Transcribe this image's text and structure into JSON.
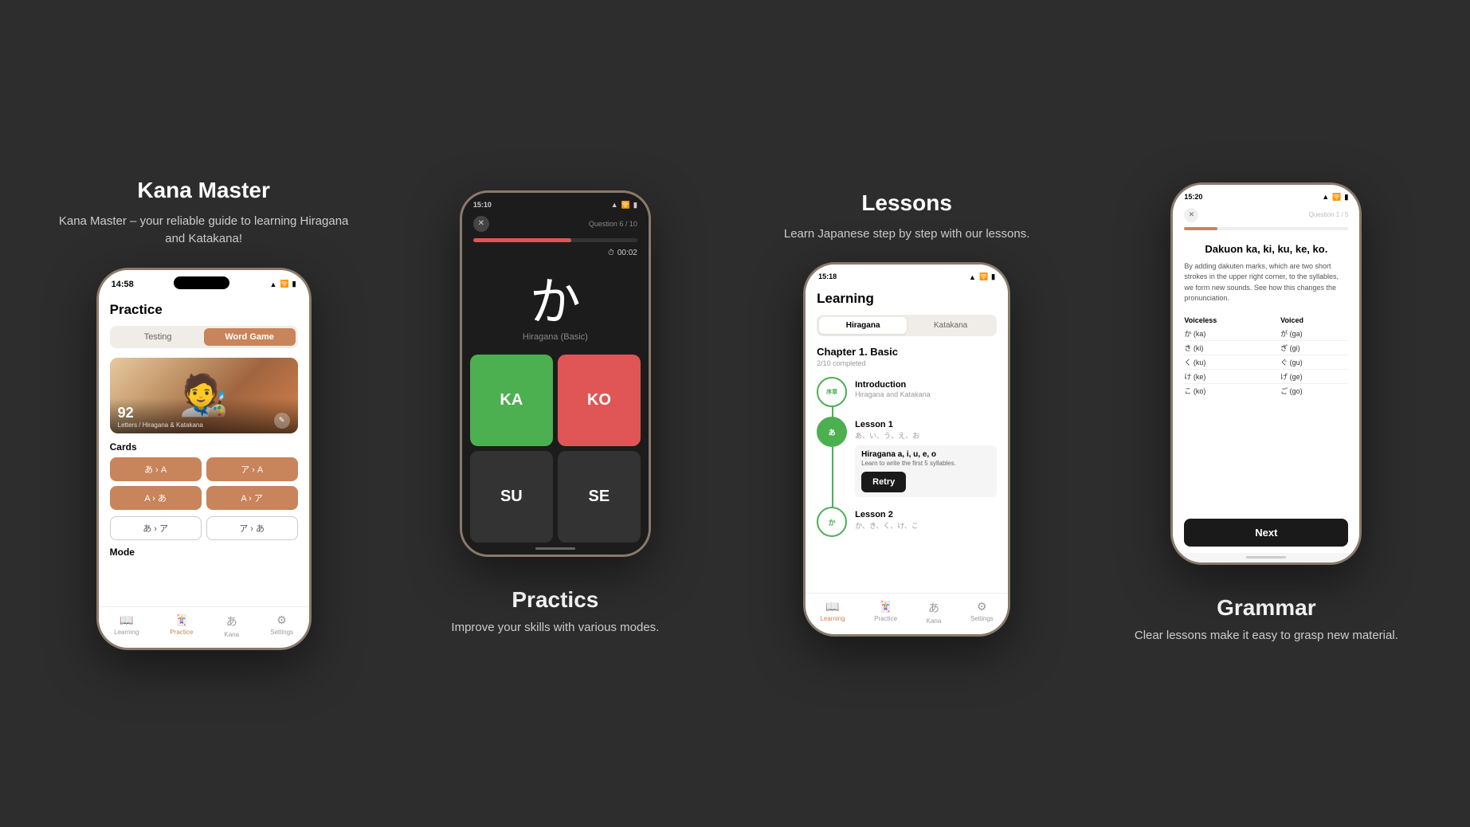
{
  "app": {
    "background": "#2d2d2d"
  },
  "section1": {
    "title": "Kana Master",
    "description": "Kana Master – your reliable guide to learning Hiragana and Katakana!",
    "phone": {
      "status_time": "14:58",
      "screen_title": "Practice",
      "tab_testing": "Testing",
      "tab_wordgame": "Word Game",
      "card_count": "92",
      "card_subtitle": "Letters / Hiragana & Katakana",
      "cards_label": "Cards",
      "btn1": "あ › A",
      "btn2": "ア › A",
      "btn3": "A › あ",
      "btn4": "A › ア",
      "outline_btn1": "あ › ア",
      "outline_btn2": "ア › あ",
      "mode_label": "Mode",
      "nav_learning": "Learning",
      "nav_practice": "Practice",
      "nav_kana": "Kana",
      "nav_settings": "Settings"
    }
  },
  "section2": {
    "title": "Practics",
    "description": "Improve your skills with various modes.",
    "phone": {
      "status_time": "15:10",
      "question_label": "Question 6 / 10",
      "timer": "00:02",
      "kana_char": "か",
      "kana_type": "Hiragana (Basic)",
      "answer_ka": "KA",
      "answer_ko": "KO",
      "answer_su": "SU",
      "answer_se": "SE"
    }
  },
  "section3": {
    "title": "Lessons",
    "description": "Learn Japanese step by step with our lessons.",
    "phone": {
      "status_time": "15:18",
      "screen_title": "Learning",
      "tab_hiragana": "Hiragana",
      "tab_katakana": "Katakana",
      "chapter_title": "Chapter 1. Basic",
      "chapter_completed": "2/10 completed",
      "intro_label": "序章",
      "intro_title": "Introduction",
      "intro_sub": "Hiragana and Katakana",
      "lesson1_label": "あ",
      "lesson1_title": "Lesson 1",
      "lesson1_sub": "あ、い、う、え、お",
      "lesson1_extra_title": "Hiragana a, i, u, e, o",
      "lesson1_extra_desc": "Learn to write the first 5 syllables.",
      "retry_label": "Retry",
      "lesson2_label": "か",
      "lesson2_title": "Lesson 2",
      "lesson2_sub": "か、き、く、け、こ",
      "nav_learning": "Learning",
      "nav_practice": "Practice",
      "nav_kana": "Kana",
      "nav_settings": "Settings"
    }
  },
  "section4": {
    "title": "Grammar",
    "description": "Clear lessons make it easy to grasp new material.",
    "phone": {
      "status_time": "15:20",
      "question_label": "Question 1 / 5",
      "lesson_heading": "Dakuon ka, ki, ku, ke, ko.",
      "lesson_body": "By adding dakuten marks, which are two short strokes in the upper right corner, to the syllables, we form new sounds. See how this changes the pronunciation.",
      "col_voiceless": "Voiceless",
      "col_voiced": "Voiced",
      "rows": [
        {
          "voiceless": "か (ka)",
          "voiced": "が (ga)"
        },
        {
          "voiceless": "き (ki)",
          "voiced": "ぎ (gi)"
        },
        {
          "voiceless": "く (ku)",
          "voiced": "ぐ (gu)"
        },
        {
          "voiceless": "け (ke)",
          "voiced": "げ (ge)"
        },
        {
          "voiceless": "こ (ko)",
          "voiced": "ご (go)"
        }
      ],
      "next_label": "Next"
    }
  }
}
